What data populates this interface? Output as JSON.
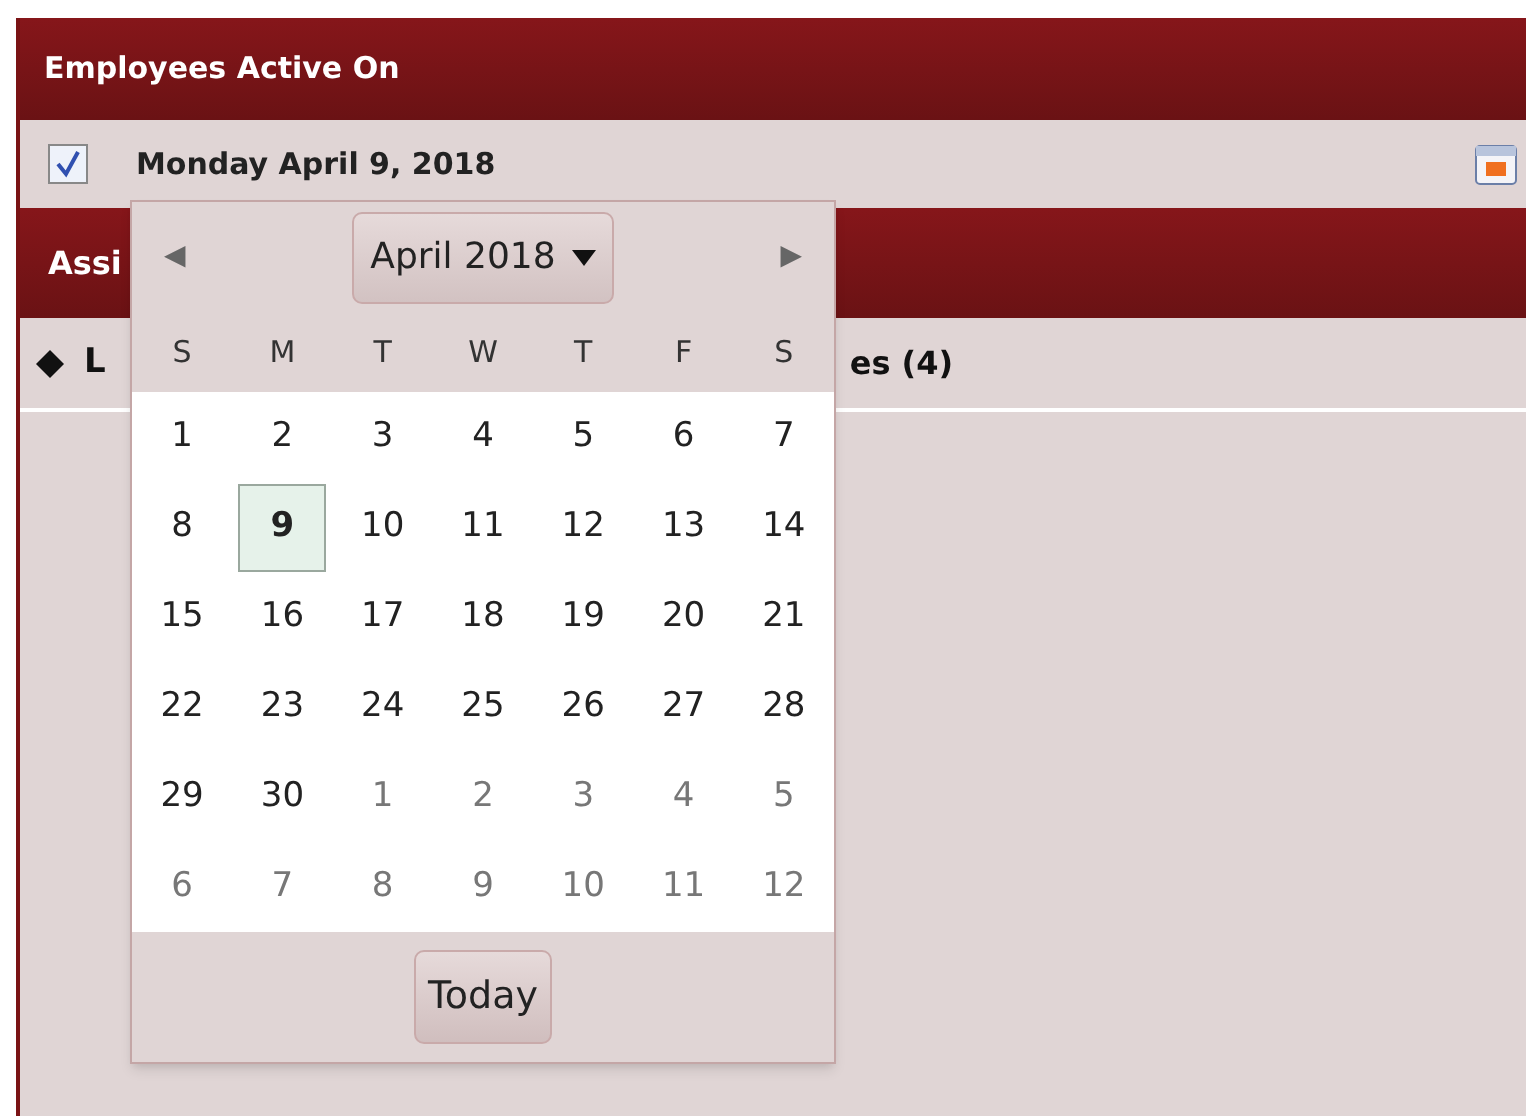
{
  "panel": {
    "title": "Employees Active On",
    "checked": true,
    "date": "Monday April 9, 2018"
  },
  "section": {
    "title": "Assi",
    "row_parts": [
      "L",
      "es (4)"
    ]
  },
  "calendar": {
    "prev": "◀",
    "month": "April 2018",
    "next": "▶",
    "weekdays": [
      "S",
      "M",
      "T",
      "W",
      "T",
      "F",
      "S"
    ],
    "weeks": [
      [
        {
          "label": "1",
          "selected": false,
          "outside": false
        },
        {
          "label": "2",
          "selected": false,
          "outside": false
        },
        {
          "label": "3",
          "selected": false,
          "outside": false
        },
        {
          "label": "4",
          "selected": false,
          "outside": false
        },
        {
          "label": "5",
          "selected": false,
          "outside": false
        },
        {
          "label": "6",
          "selected": false,
          "outside": false
        },
        {
          "label": "7",
          "selected": false,
          "outside": false
        }
      ],
      [
        {
          "label": "8",
          "selected": false,
          "outside": false
        },
        {
          "label": "9",
          "selected": true,
          "outside": false
        },
        {
          "label": "10",
          "selected": false,
          "outside": false
        },
        {
          "label": "11",
          "selected": false,
          "outside": false
        },
        {
          "label": "12",
          "selected": false,
          "outside": false
        },
        {
          "label": "13",
          "selected": false,
          "outside": false
        },
        {
          "label": "14",
          "selected": false,
          "outside": false
        }
      ],
      [
        {
          "label": "15",
          "selected": false,
          "outside": false
        },
        {
          "label": "16",
          "selected": false,
          "outside": false
        },
        {
          "label": "17",
          "selected": false,
          "outside": false
        },
        {
          "label": "18",
          "selected": false,
          "outside": false
        },
        {
          "label": "19",
          "selected": false,
          "outside": false
        },
        {
          "label": "20",
          "selected": false,
          "outside": false
        },
        {
          "label": "21",
          "selected": false,
          "outside": false
        }
      ],
      [
        {
          "label": "22",
          "selected": false,
          "outside": false
        },
        {
          "label": "23",
          "selected": false,
          "outside": false
        },
        {
          "label": "24",
          "selected": false,
          "outside": false
        },
        {
          "label": "25",
          "selected": false,
          "outside": false
        },
        {
          "label": "26",
          "selected": false,
          "outside": false
        },
        {
          "label": "27",
          "selected": false,
          "outside": false
        },
        {
          "label": "28",
          "selected": false,
          "outside": false
        }
      ],
      [
        {
          "label": "29",
          "selected": false,
          "outside": false
        },
        {
          "label": "30",
          "selected": false,
          "outside": false
        },
        {
          "label": "1",
          "selected": false,
          "outside": true
        },
        {
          "label": "2",
          "selected": false,
          "outside": true
        },
        {
          "label": "3",
          "selected": false,
          "outside": true
        },
        {
          "label": "4",
          "selected": false,
          "outside": true
        },
        {
          "label": "5",
          "selected": false,
          "outside": true
        }
      ],
      [
        {
          "label": "6",
          "selected": false,
          "outside": true
        },
        {
          "label": "7",
          "selected": false,
          "outside": true
        },
        {
          "label": "8",
          "selected": false,
          "outside": true
        },
        {
          "label": "9",
          "selected": false,
          "outside": true
        },
        {
          "label": "10",
          "selected": false,
          "outside": true
        },
        {
          "label": "11",
          "selected": false,
          "outside": true
        },
        {
          "label": "12",
          "selected": false,
          "outside": true
        }
      ]
    ],
    "today": "Today"
  }
}
